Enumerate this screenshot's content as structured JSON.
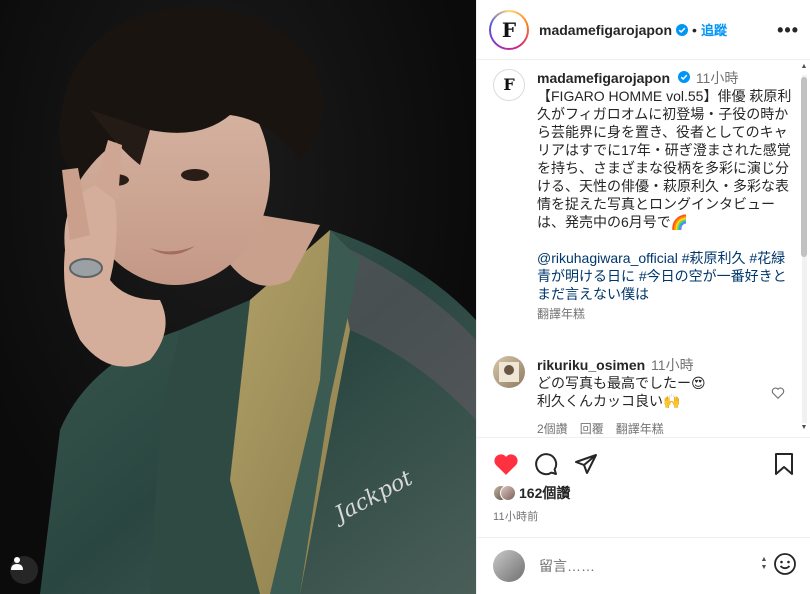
{
  "post": {
    "image_alt": "Portrait photo",
    "pin_text": "Jackpot"
  },
  "header": {
    "username": "madamefigarojapon",
    "separator": "•",
    "follow_label": "追蹤",
    "more_label": "•••",
    "avatar_letter": "F"
  },
  "caption": {
    "username": "madamefigarojapon",
    "time": "11小時",
    "text": "【FIGARO HOMME vol.55】俳優 萩原利久がフィガロオムに初登場・子役の時から芸能界に身を置き、役者としてのキャリアはすでに17年・研ぎ澄まされた感覚を持ち、さまざまな役柄を多彩に演じ分ける、天性の俳優・萩原利久・多彩な表情を捉えた写真とロングインタビューは、発売中の6月号で🌈",
    "tags": "@rikuhagiwara_official #萩原利久 #花緑青が明ける日に #今日の空が一番好きとまだ言えない僕は",
    "translate_label": "翻譯年糕"
  },
  "comment": {
    "username": "rikuriku_osimen",
    "time": "11小時",
    "line1": "どの写真も最高でしたー😍",
    "line2": "利久くんカッコ良い🙌",
    "likes_label": "2個讚",
    "reply_label": "回覆",
    "translate_label": "翻譯年糕"
  },
  "actions": {
    "likes": "162個讚",
    "posted_time": "11小時前"
  },
  "add_comment": {
    "placeholder": "留言……"
  },
  "colors": {
    "accent": "#0095f6",
    "like_red": "#ff3040",
    "link": "#00376b",
    "muted": "#737373"
  }
}
